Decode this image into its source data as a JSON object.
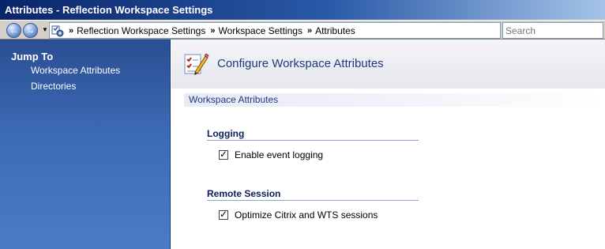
{
  "window": {
    "title": "Attributes - Reflection Workspace Settings"
  },
  "navbar": {
    "breadcrumbs": [
      "Reflection Workspace Settings",
      "Workspace Settings",
      "Attributes"
    ],
    "search_placeholder": "Search"
  },
  "sidebar": {
    "heading": "Jump To",
    "links": [
      "Workspace Attributes",
      "Directories"
    ]
  },
  "main": {
    "header_title": "Configure Workspace Attributes",
    "section_title": "Workspace Attributes",
    "groups": [
      {
        "title": "Logging",
        "option_label": "Enable event logging",
        "checked": true
      },
      {
        "title": "Remote Session",
        "option_label": "Optimize Citrix and WTS sessions",
        "checked": true
      }
    ]
  },
  "icons": {
    "back": "back-arrow-icon",
    "forward": "forward-arrow-icon",
    "address": "settings-gears-icon",
    "header": "checklist-pencil-icon"
  },
  "colors": {
    "title_bar": "#0a246a",
    "sidebar": "#3c6bb4",
    "accent_text": "#1c3a80"
  }
}
